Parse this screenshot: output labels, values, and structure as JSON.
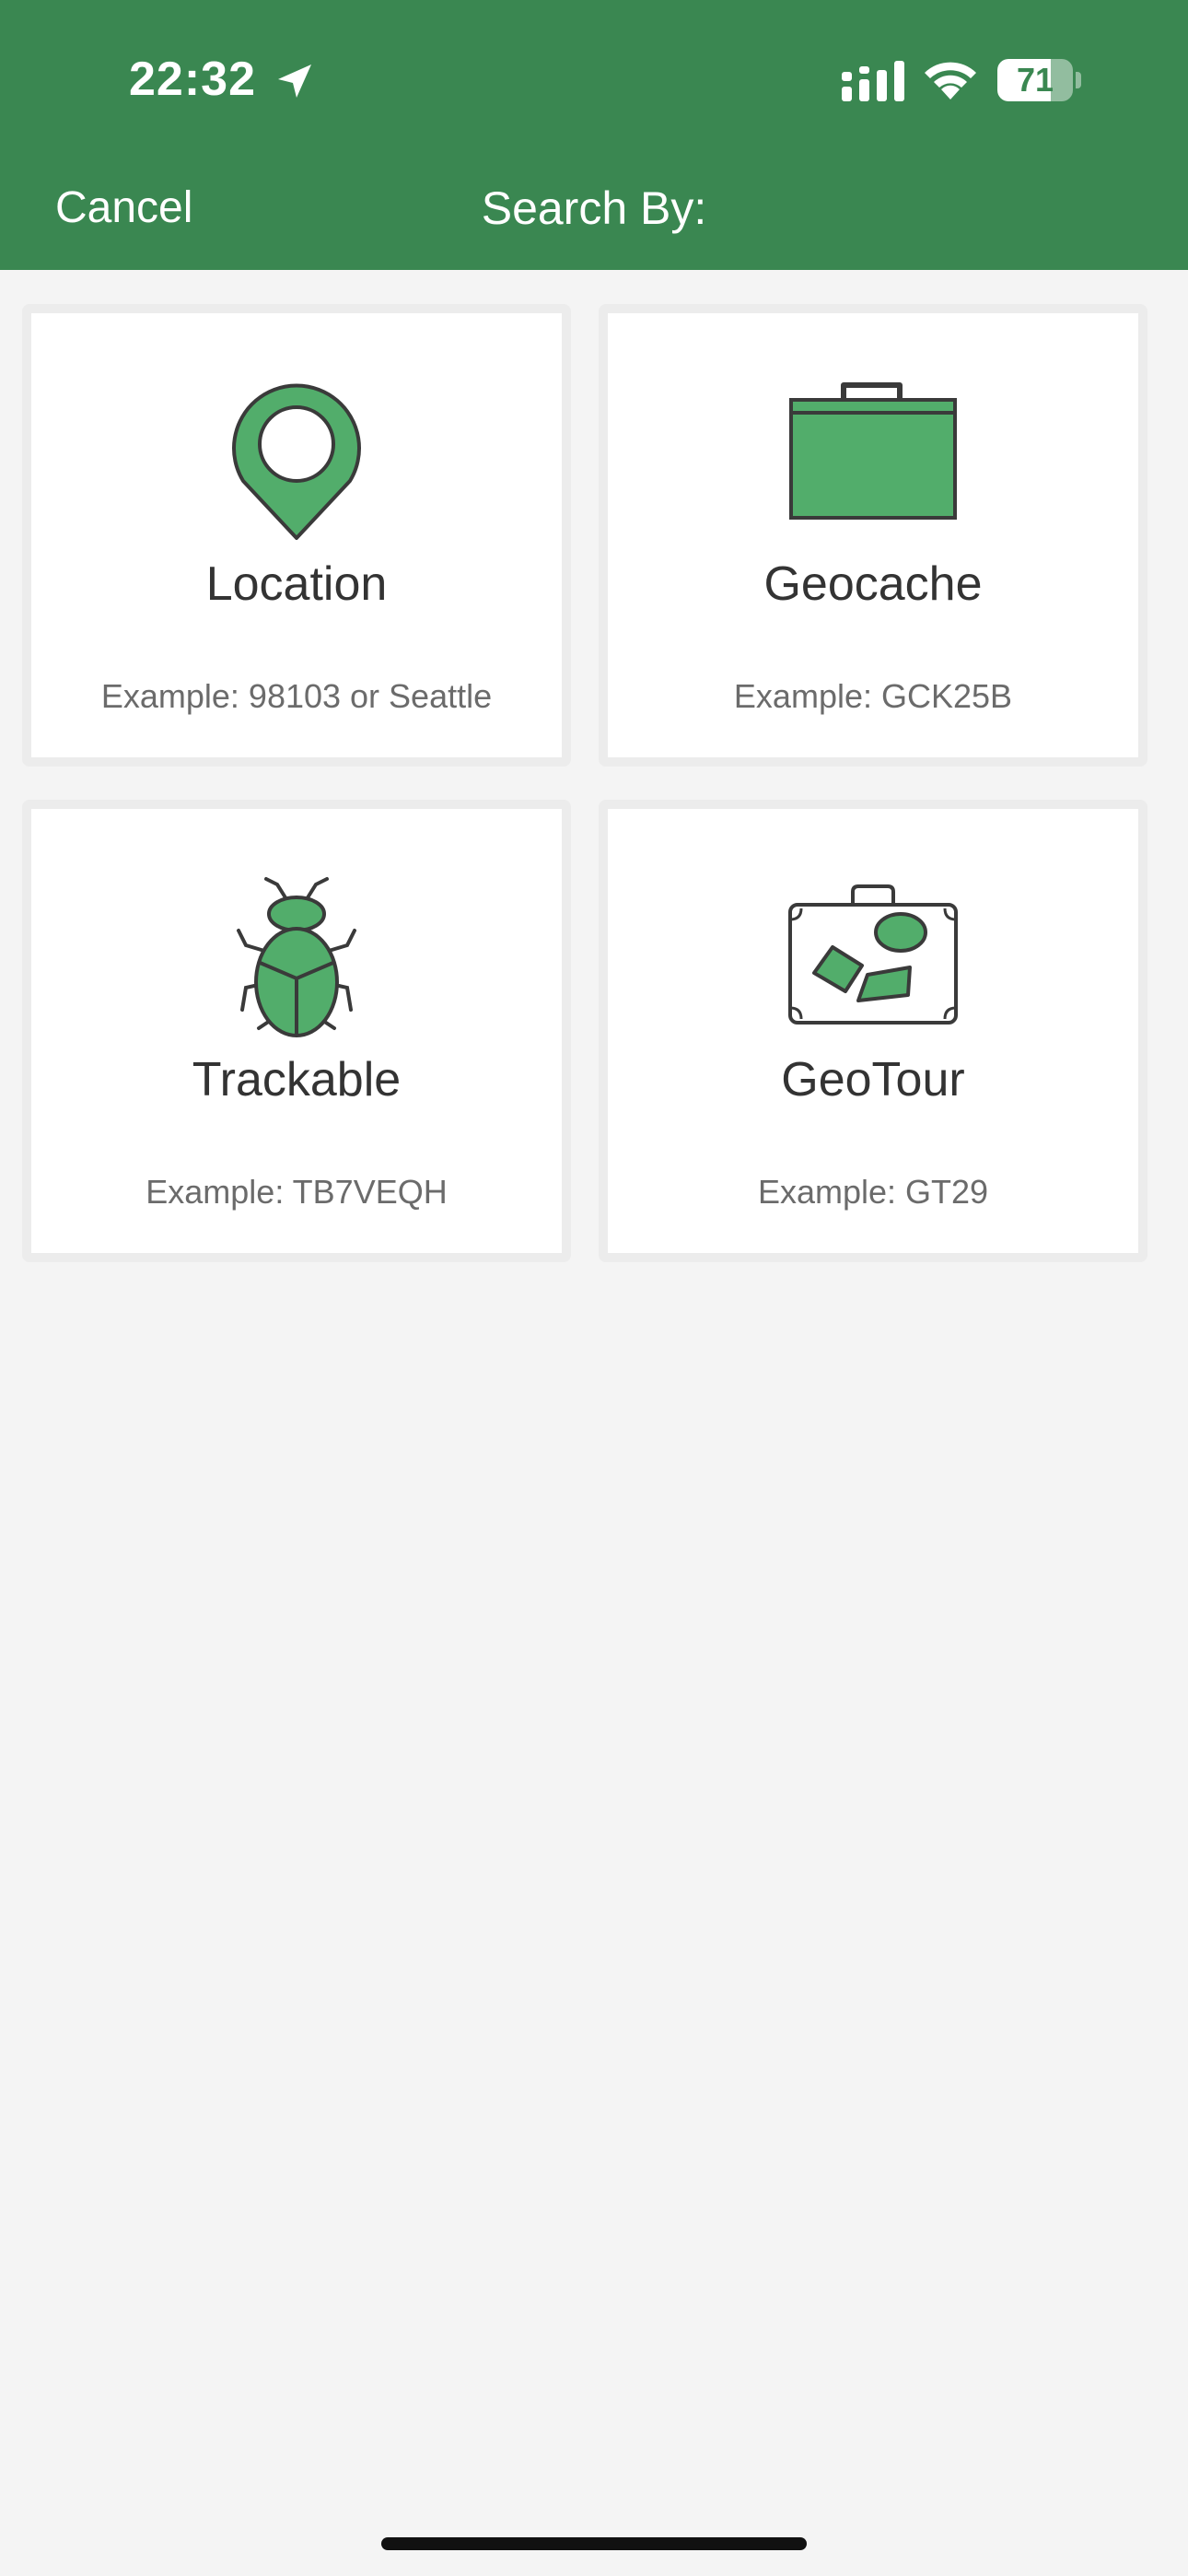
{
  "status_bar": {
    "time": "22:32",
    "battery": "71",
    "battery_level": 0.71
  },
  "header": {
    "cancel_label": "Cancel",
    "title": "Search By:"
  },
  "options": [
    {
      "title": "Location",
      "example": "Example: 98103 or Seattle",
      "icon": "map-pin-icon"
    },
    {
      "title": "Geocache",
      "example": "Example: GCK25B",
      "icon": "cache-box-icon"
    },
    {
      "title": "Trackable",
      "example": "Example: TB7VEQH",
      "icon": "bug-icon"
    },
    {
      "title": "GeoTour",
      "example": "Example: GT29",
      "icon": "suitcase-icon"
    }
  ],
  "colors": {
    "header_bg": "#3a8751",
    "icon_fill": "#52ad6b",
    "icon_stroke": "#3a3a3a",
    "background": "#f4f4f4"
  }
}
